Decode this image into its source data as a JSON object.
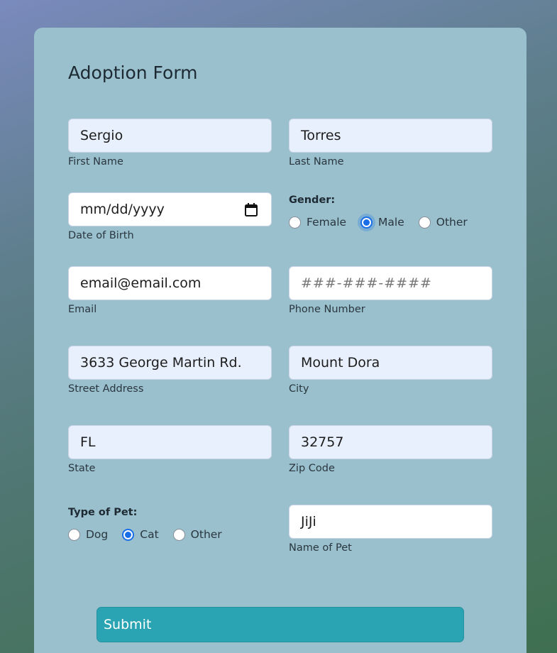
{
  "form": {
    "title": "Adoption Form",
    "first_name": {
      "value": "Sergio",
      "label": "First Name"
    },
    "last_name": {
      "value": "Torres",
      "label": "Last Name"
    },
    "dob": {
      "placeholder": "mm/dd/yyyy",
      "label": "Date of Birth"
    },
    "gender": {
      "title": "Gender:",
      "options": [
        "Female",
        "Male",
        "Other"
      ],
      "selected": "Male"
    },
    "email": {
      "value": "email@email.com",
      "label": "Email"
    },
    "phone": {
      "placeholder": "###-###-####",
      "label": "Phone Number"
    },
    "street": {
      "value": "3633 George Martin Rd.",
      "label": "Street Address"
    },
    "city": {
      "value": "Mount Dora",
      "label": "City"
    },
    "state": {
      "value": "FL",
      "label": "State"
    },
    "zip": {
      "value": "32757",
      "label": "Zip Code"
    },
    "pet_type": {
      "title": "Type of Pet:",
      "options": [
        "Dog",
        "Cat",
        "Other"
      ],
      "selected": "Cat"
    },
    "pet_name": {
      "value": "JiJi",
      "label": "Name of Pet"
    },
    "submit_label": "Submit"
  },
  "colors": {
    "card_bg": "#99c0cc",
    "autofill_bg": "#e8f0fe",
    "radio_accent": "#1a6fe8",
    "submit_bg": "#2aa3b2"
  },
  "icons": {
    "date_picker": "calendar-icon"
  }
}
